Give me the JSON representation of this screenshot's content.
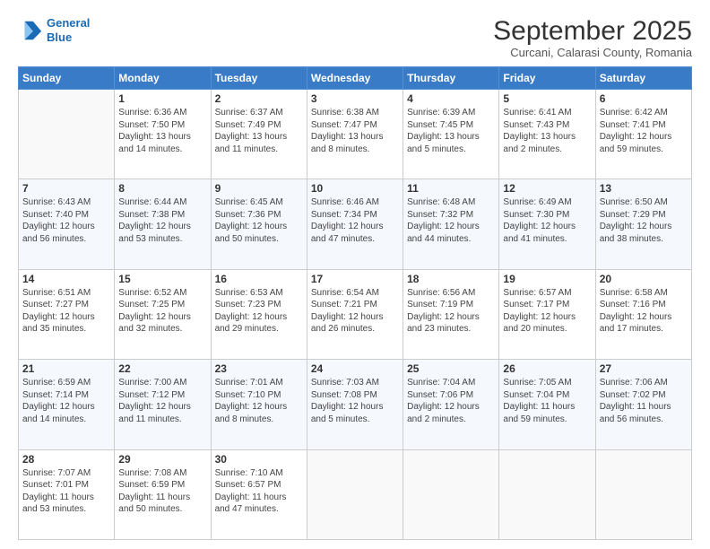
{
  "header": {
    "logo_line1": "General",
    "logo_line2": "Blue",
    "month": "September 2025",
    "location": "Curcani, Calarasi County, Romania"
  },
  "weekdays": [
    "Sunday",
    "Monday",
    "Tuesday",
    "Wednesday",
    "Thursday",
    "Friday",
    "Saturday"
  ],
  "weeks": [
    [
      {
        "day": "",
        "text": ""
      },
      {
        "day": "1",
        "text": "Sunrise: 6:36 AM\nSunset: 7:50 PM\nDaylight: 13 hours\nand 14 minutes."
      },
      {
        "day": "2",
        "text": "Sunrise: 6:37 AM\nSunset: 7:49 PM\nDaylight: 13 hours\nand 11 minutes."
      },
      {
        "day": "3",
        "text": "Sunrise: 6:38 AM\nSunset: 7:47 PM\nDaylight: 13 hours\nand 8 minutes."
      },
      {
        "day": "4",
        "text": "Sunrise: 6:39 AM\nSunset: 7:45 PM\nDaylight: 13 hours\nand 5 minutes."
      },
      {
        "day": "5",
        "text": "Sunrise: 6:41 AM\nSunset: 7:43 PM\nDaylight: 13 hours\nand 2 minutes."
      },
      {
        "day": "6",
        "text": "Sunrise: 6:42 AM\nSunset: 7:41 PM\nDaylight: 12 hours\nand 59 minutes."
      }
    ],
    [
      {
        "day": "7",
        "text": "Sunrise: 6:43 AM\nSunset: 7:40 PM\nDaylight: 12 hours\nand 56 minutes."
      },
      {
        "day": "8",
        "text": "Sunrise: 6:44 AM\nSunset: 7:38 PM\nDaylight: 12 hours\nand 53 minutes."
      },
      {
        "day": "9",
        "text": "Sunrise: 6:45 AM\nSunset: 7:36 PM\nDaylight: 12 hours\nand 50 minutes."
      },
      {
        "day": "10",
        "text": "Sunrise: 6:46 AM\nSunset: 7:34 PM\nDaylight: 12 hours\nand 47 minutes."
      },
      {
        "day": "11",
        "text": "Sunrise: 6:48 AM\nSunset: 7:32 PM\nDaylight: 12 hours\nand 44 minutes."
      },
      {
        "day": "12",
        "text": "Sunrise: 6:49 AM\nSunset: 7:30 PM\nDaylight: 12 hours\nand 41 minutes."
      },
      {
        "day": "13",
        "text": "Sunrise: 6:50 AM\nSunset: 7:29 PM\nDaylight: 12 hours\nand 38 minutes."
      }
    ],
    [
      {
        "day": "14",
        "text": "Sunrise: 6:51 AM\nSunset: 7:27 PM\nDaylight: 12 hours\nand 35 minutes."
      },
      {
        "day": "15",
        "text": "Sunrise: 6:52 AM\nSunset: 7:25 PM\nDaylight: 12 hours\nand 32 minutes."
      },
      {
        "day": "16",
        "text": "Sunrise: 6:53 AM\nSunset: 7:23 PM\nDaylight: 12 hours\nand 29 minutes."
      },
      {
        "day": "17",
        "text": "Sunrise: 6:54 AM\nSunset: 7:21 PM\nDaylight: 12 hours\nand 26 minutes."
      },
      {
        "day": "18",
        "text": "Sunrise: 6:56 AM\nSunset: 7:19 PM\nDaylight: 12 hours\nand 23 minutes."
      },
      {
        "day": "19",
        "text": "Sunrise: 6:57 AM\nSunset: 7:17 PM\nDaylight: 12 hours\nand 20 minutes."
      },
      {
        "day": "20",
        "text": "Sunrise: 6:58 AM\nSunset: 7:16 PM\nDaylight: 12 hours\nand 17 minutes."
      }
    ],
    [
      {
        "day": "21",
        "text": "Sunrise: 6:59 AM\nSunset: 7:14 PM\nDaylight: 12 hours\nand 14 minutes."
      },
      {
        "day": "22",
        "text": "Sunrise: 7:00 AM\nSunset: 7:12 PM\nDaylight: 12 hours\nand 11 minutes."
      },
      {
        "day": "23",
        "text": "Sunrise: 7:01 AM\nSunset: 7:10 PM\nDaylight: 12 hours\nand 8 minutes."
      },
      {
        "day": "24",
        "text": "Sunrise: 7:03 AM\nSunset: 7:08 PM\nDaylight: 12 hours\nand 5 minutes."
      },
      {
        "day": "25",
        "text": "Sunrise: 7:04 AM\nSunset: 7:06 PM\nDaylight: 12 hours\nand 2 minutes."
      },
      {
        "day": "26",
        "text": "Sunrise: 7:05 AM\nSunset: 7:04 PM\nDaylight: 11 hours\nand 59 minutes."
      },
      {
        "day": "27",
        "text": "Sunrise: 7:06 AM\nSunset: 7:02 PM\nDaylight: 11 hours\nand 56 minutes."
      }
    ],
    [
      {
        "day": "28",
        "text": "Sunrise: 7:07 AM\nSunset: 7:01 PM\nDaylight: 11 hours\nand 53 minutes."
      },
      {
        "day": "29",
        "text": "Sunrise: 7:08 AM\nSunset: 6:59 PM\nDaylight: 11 hours\nand 50 minutes."
      },
      {
        "day": "30",
        "text": "Sunrise: 7:10 AM\nSunset: 6:57 PM\nDaylight: 11 hours\nand 47 minutes."
      },
      {
        "day": "",
        "text": ""
      },
      {
        "day": "",
        "text": ""
      },
      {
        "day": "",
        "text": ""
      },
      {
        "day": "",
        "text": ""
      }
    ]
  ]
}
